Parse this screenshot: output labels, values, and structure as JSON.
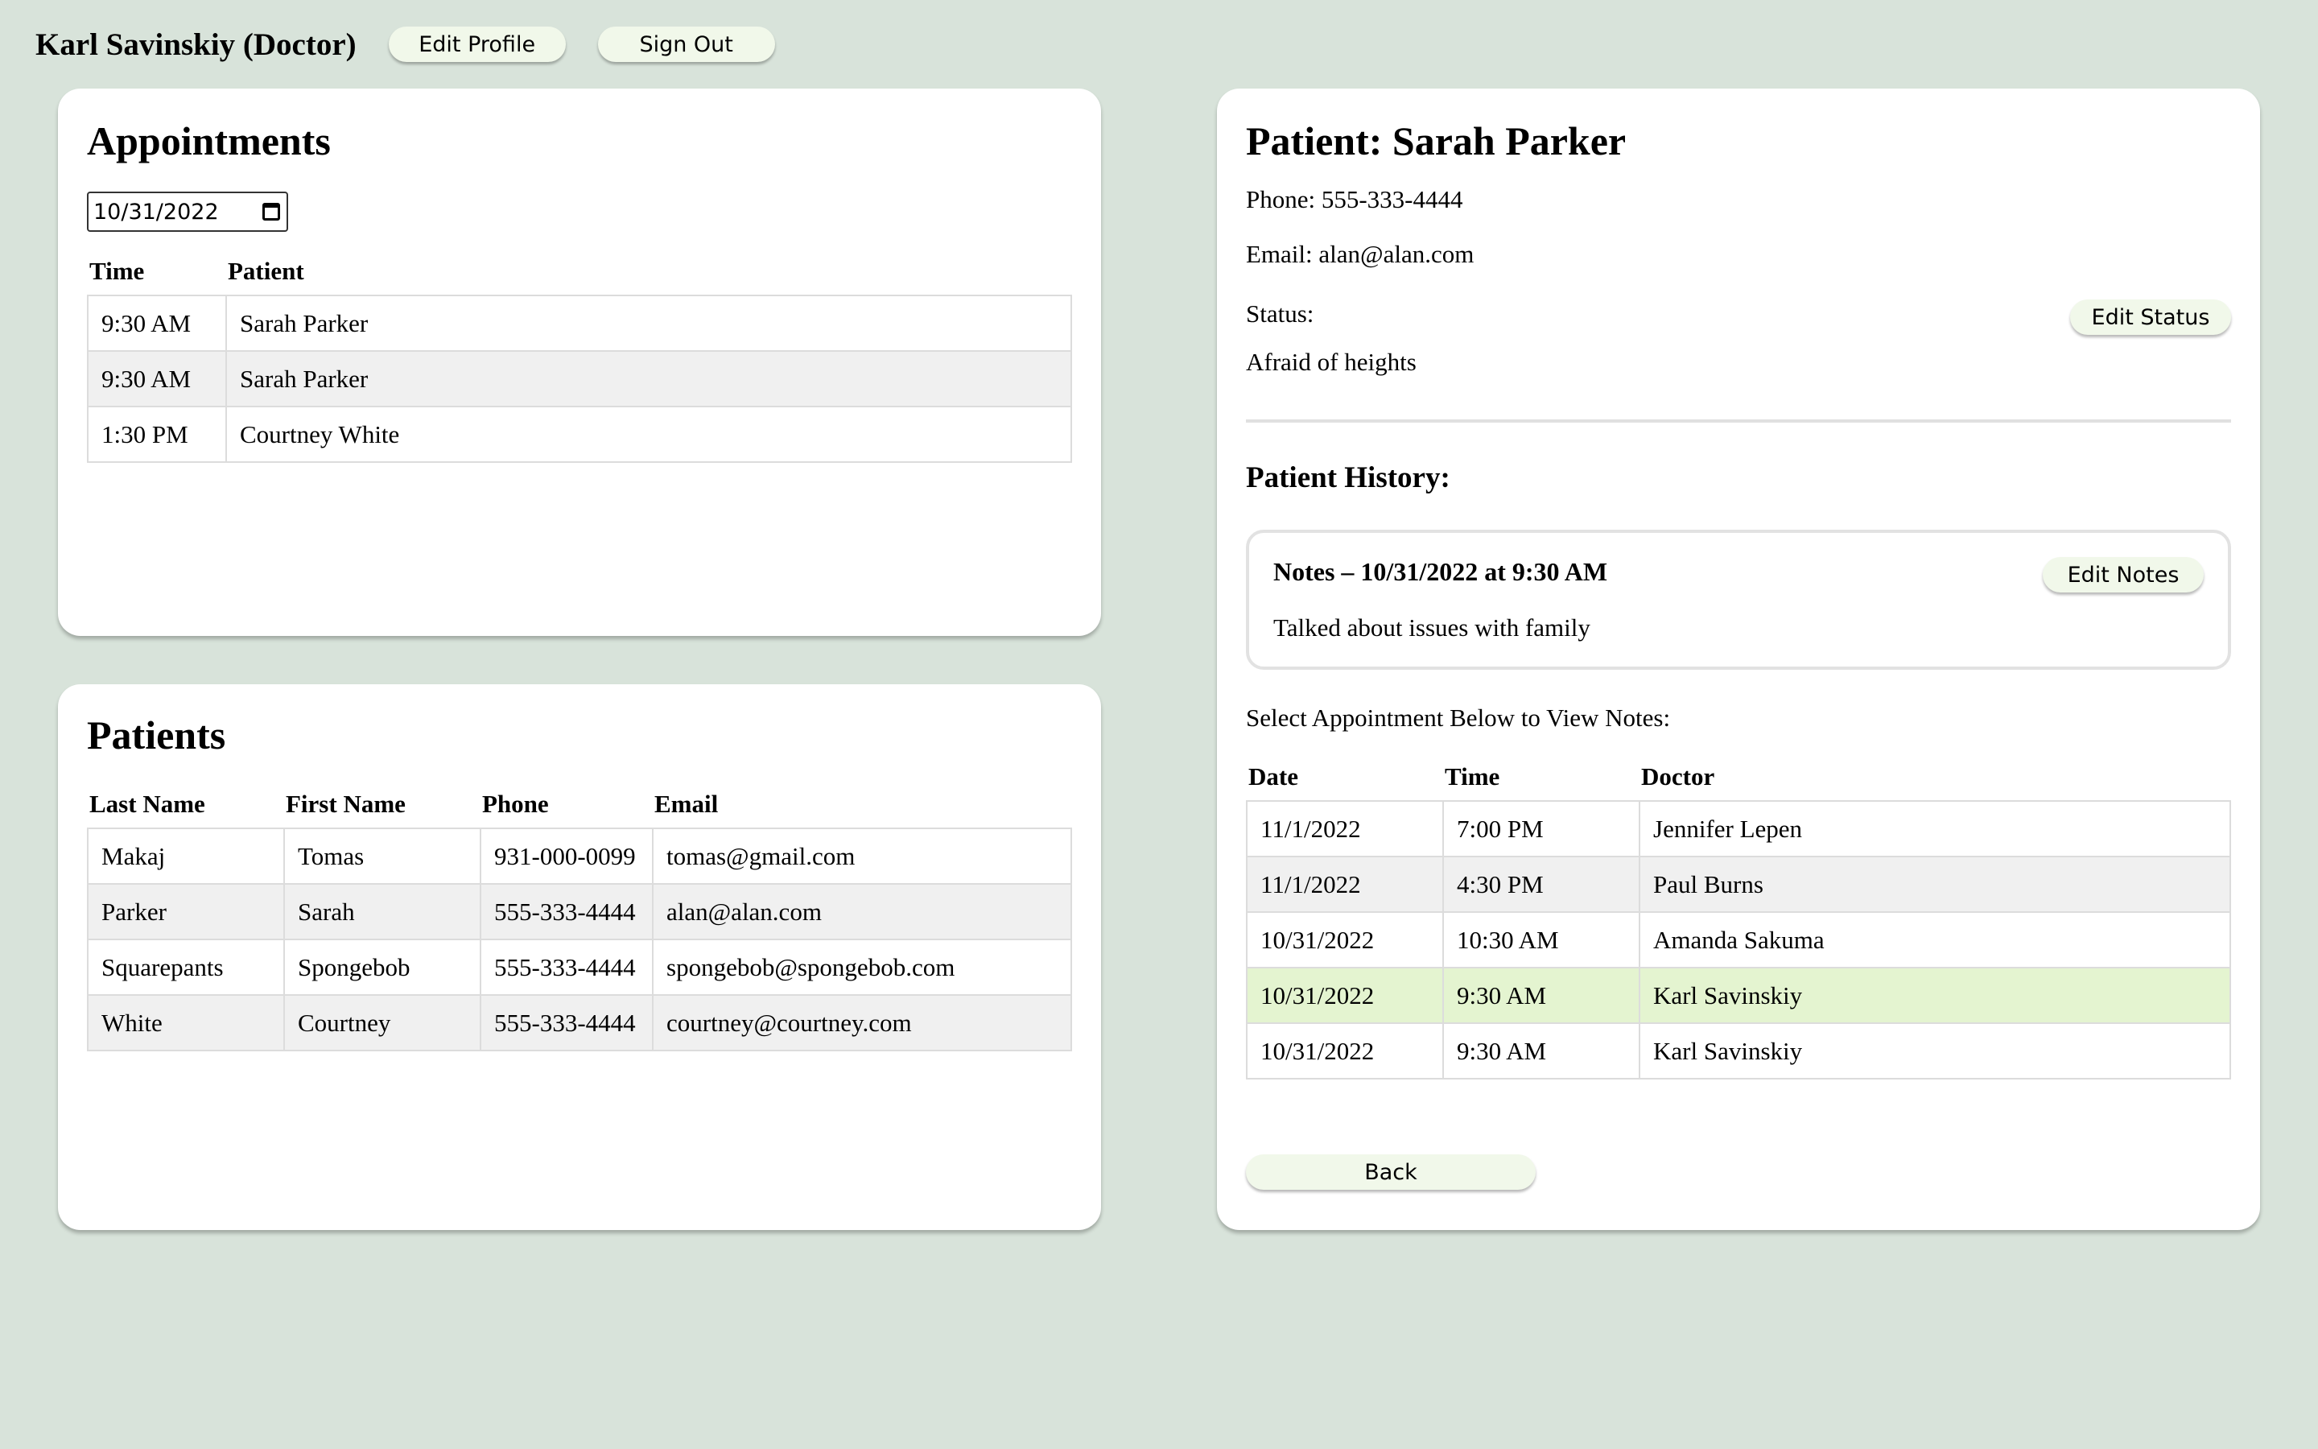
{
  "header": {
    "user_title": "Karl Savinskiy (Doctor)",
    "edit_profile_label": "Edit Profile",
    "sign_out_label": "Sign Out"
  },
  "appointments": {
    "title": "Appointments",
    "date_value": "10/31/2022",
    "columns": [
      "Time",
      "Patient"
    ],
    "rows": [
      [
        "9:30 AM",
        "Sarah Parker"
      ],
      [
        "9:30 AM",
        "Sarah Parker"
      ],
      [
        "1:30 PM",
        "Courtney White"
      ]
    ]
  },
  "patients": {
    "title": "Patients",
    "columns": [
      "Last Name",
      "First Name",
      "Phone",
      "Email"
    ],
    "rows": [
      [
        "Makaj",
        "Tomas",
        "931-000-0099",
        "tomas@gmail.com"
      ],
      [
        "Parker",
        "Sarah",
        "555-333-4444",
        "alan@alan.com"
      ],
      [
        "Squarepants",
        "Spongebob",
        "555-333-4444",
        "spongebob@spongebob.com"
      ],
      [
        "White",
        "Courtney",
        "555-333-4444",
        "courtney@courtney.com"
      ]
    ]
  },
  "patient_detail": {
    "title": "Patient: Sarah Parker",
    "phone_line": "Phone: 555-333-4444",
    "email_line": "Email: alan@alan.com",
    "status_label": "Status:",
    "status_value": "Afraid of heights",
    "edit_status_label": "Edit Status",
    "history_title": "Patient History:",
    "notes": {
      "heading": "Notes – 10/31/2022 at 9:30 AM",
      "text": "Talked about issues with family",
      "edit_notes_label": "Edit Notes"
    },
    "select_prompt": "Select Appointment Below to View Notes:",
    "history_columns": [
      "Date",
      "Time",
      "Doctor"
    ],
    "history_rows": [
      [
        "11/1/2022",
        "7:00 PM",
        "Jennifer Lepen"
      ],
      [
        "11/1/2022",
        "4:30 PM",
        "Paul Burns"
      ],
      [
        "10/31/2022",
        "10:30 AM",
        "Amanda Sakuma"
      ],
      [
        "10/31/2022",
        "9:30 AM",
        "Karl Savinskiy"
      ],
      [
        "10/31/2022",
        "9:30 AM",
        "Karl Savinskiy"
      ]
    ],
    "selected_history_row": 3,
    "back_label": "Back"
  },
  "colors": {
    "page_background": "#d8e3da",
    "button_background": "#f1f8ea",
    "selected_row": "#e4f4d0",
    "striped_row": "#f0f0f0"
  },
  "icons": {
    "date_picker": "calendar-icon"
  }
}
